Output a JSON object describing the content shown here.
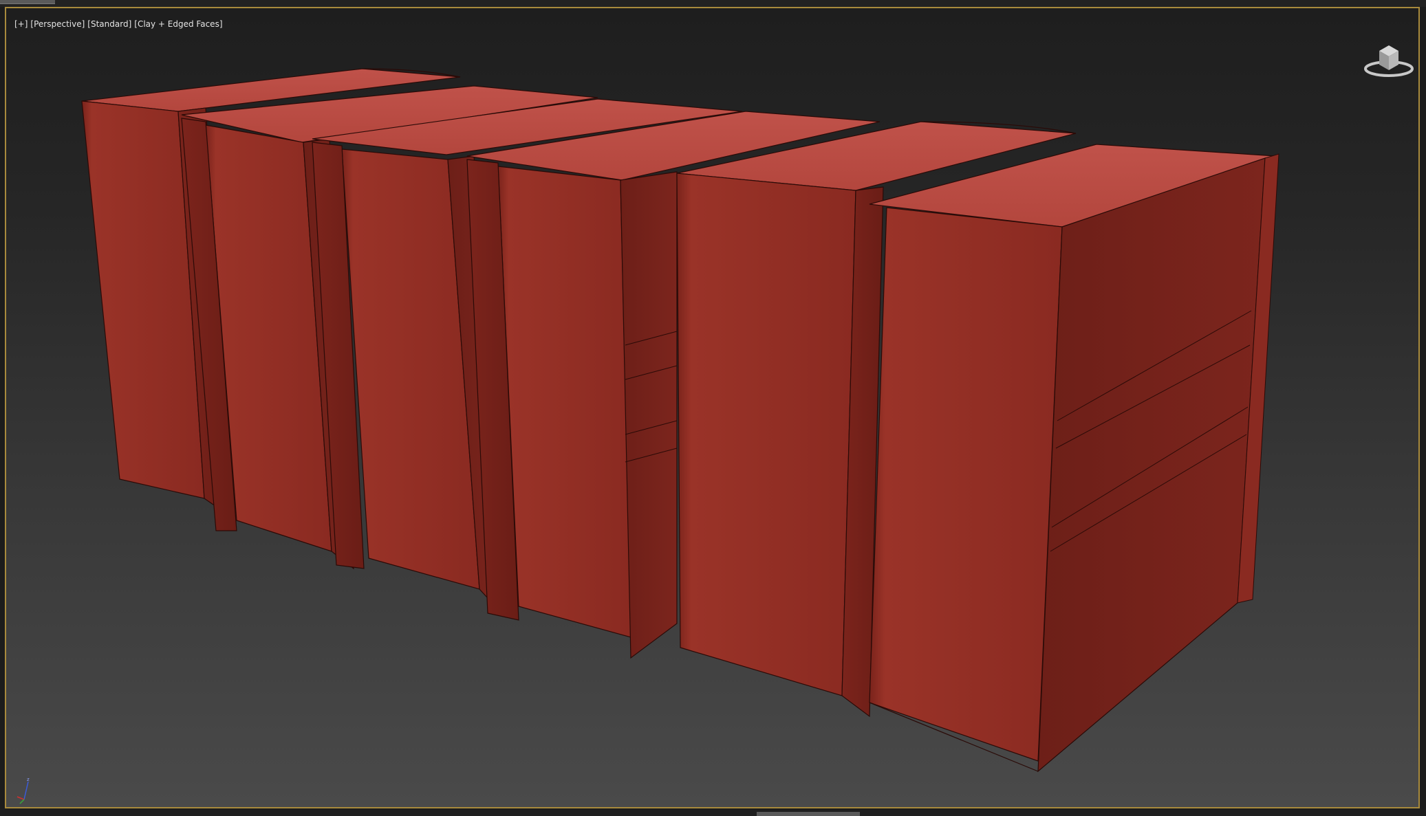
{
  "viewport": {
    "labels": [
      "[+]",
      "[Perspective]",
      "[Standard]",
      "[Clay + Edged Faces]"
    ],
    "shading_mode": "Clay + Edged Faces"
  },
  "scene": {
    "object_count": 6,
    "object_type": "book",
    "clay_color": "#8d2c22"
  },
  "viewcube": {
    "icon": "viewcube-icon"
  },
  "axis": {
    "icon": "axis-tripod-icon"
  },
  "colors": {
    "frame_border": "#a88a3c",
    "clay": "#8d2c22",
    "clay_light": "#b8453a",
    "clay_dark": "#6e1f18",
    "edge": "#2a0a07"
  }
}
